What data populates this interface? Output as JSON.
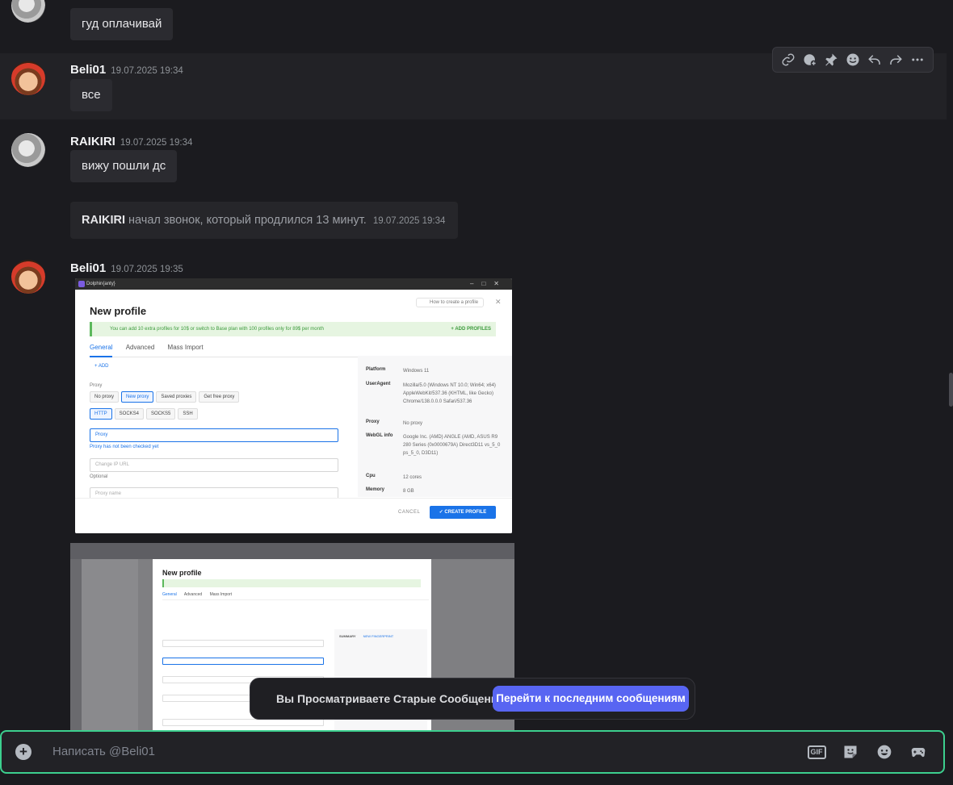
{
  "messages": [
    {
      "text": "гуд оплачивай"
    },
    {
      "author": "Beli01",
      "timestamp": "19.07.2025 19:34",
      "text": "все"
    },
    {
      "author": "RAIKIRI",
      "timestamp": "19.07.2025 19:34",
      "text": "вижу пошли дс"
    },
    {
      "author": "Beli01",
      "timestamp": "19.07.2025 19:35"
    }
  ],
  "system_message": {
    "author": "RAIKIRI",
    "text": "начал звонок, который продлился 13 минут.",
    "timestamp": "19.07.2025 19:34"
  },
  "hover_toolbar": {
    "icons": [
      "link-icon",
      "add-reaction-icon",
      "pin-icon",
      "emoji-icon",
      "reply-icon",
      "forward-icon",
      "more-icon"
    ]
  },
  "attachment1": {
    "window_title": "Dolphin{anty}",
    "title": "New profile",
    "howto": "How to create a profile",
    "promo": "You can add 10 extra profiles for 10$ or switch to Base plan with 100 profiles only for 89$ per month",
    "promo_action": "+ ADD PROFILES",
    "tabs": [
      "General",
      "Advanced",
      "Mass Import"
    ],
    "add_label": "+ ADD",
    "proxy_label": "Proxy",
    "proxy_options": [
      "No proxy",
      "New proxy",
      "Saved proxies",
      "Get free proxy"
    ],
    "proxy_types": [
      "HTTP",
      "SOCKS4",
      "SOCKS5",
      "SSH"
    ],
    "proxy_field_label": "Proxy",
    "proxy_hint": "Proxy has not been checked yet",
    "change_ip_placeholder": "Change IP URL",
    "optional": "Optional",
    "proxy_name_placeholder": "Proxy name",
    "summary": [
      {
        "key": "Platform",
        "value": "Windows 11"
      },
      {
        "key": "UserAgent",
        "value": "Mozilla/5.0 (Windows NT 10.0; Win64; x64) AppleWebKit/537.36 (KHTML, like Gecko) Chrome/138.0.0.0 Safari/537.36"
      },
      {
        "key": "Proxy",
        "value": "No proxy"
      },
      {
        "key": "WebGL info",
        "value": "Google Inc. (AMD) ANGLE (AMD, ASUS R9 280 Series (0x0000679A) Direct3D11 vs_5_0 ps_5_0, D3D11)"
      },
      {
        "key": "Cpu",
        "value": "12 cores"
      },
      {
        "key": "Memory",
        "value": "8 GB"
      }
    ],
    "cancel": "CANCEL",
    "create": "✓ CREATE PROFILE"
  },
  "attachment2": {
    "title": "New profile",
    "tabs": [
      "General",
      "Advanced",
      "Mass Import"
    ],
    "summary_title": "SUMMARY",
    "new_fingerprint": "NEW FINGERPRINT"
  },
  "banner": {
    "text": "Вы Просматриваете Старые Сообщения",
    "button": "Перейти к последним сообщениям"
  },
  "composer": {
    "placeholder": "Написать @Beli01",
    "gif": "GIF"
  }
}
